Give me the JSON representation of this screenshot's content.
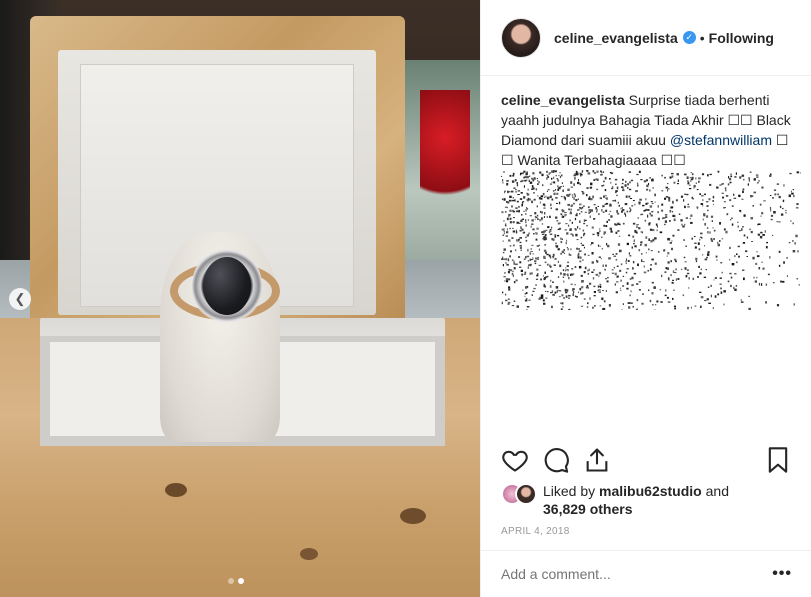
{
  "post": {
    "carousel_prev_icon": "chevron-left-icon",
    "carousel": {
      "total": 2,
      "current": 2
    }
  },
  "header": {
    "username": "celine_evangelista",
    "verified_icon": "verified-badge-icon",
    "separator": "•",
    "follow_label": "Following"
  },
  "caption": {
    "username": "celine_evangelista",
    "line_text": "Surprise tiada berhenti yaahh judulnya Bahagia Tiada Akhir ☐☐ Black Diamond dari suamiii akuu ",
    "mention": "@stefannwilliam",
    "tail_text": " ☐ ☐ Wanita Terbahagiaaaa ☐☐"
  },
  "actions": {
    "like_icon": "heart-icon",
    "comment_icon": "comment-icon",
    "share_icon": "share-icon",
    "save_icon": "bookmark-icon"
  },
  "likes": {
    "prefix": "Liked by ",
    "user": "malibu62studio",
    "middle": " and",
    "count_text": "36,829 others"
  },
  "date": "APRIL 4, 2018",
  "comment": {
    "placeholder": "Add a comment...",
    "more_label": "•••"
  },
  "colors": {
    "link": "#003569",
    "verified": "#3897f0",
    "muted": "#999999"
  }
}
